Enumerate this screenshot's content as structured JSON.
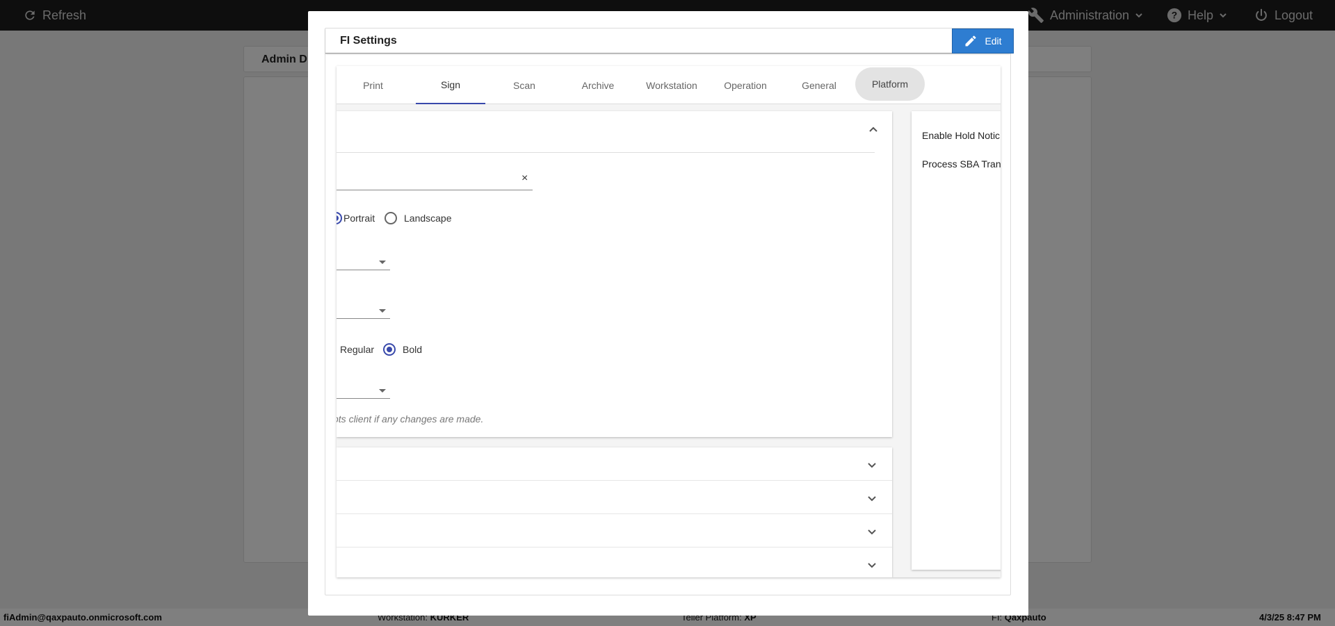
{
  "topbar": {
    "refresh_label": "Refresh",
    "administration_label": "Administration",
    "help_label": "Help",
    "logout_label": "Logout"
  },
  "page": {
    "title": "Admin D"
  },
  "footer": {
    "user": "fiAdmin@qaxpauto.onmicrosoft.com",
    "workstation_label": "Workstation:",
    "workstation_value": "KURKER",
    "platform_label": "Teller Platform:",
    "platform_value": "XP",
    "fi_label": "FI:",
    "fi_value": "Qaxpauto",
    "datetime": "4/3/25 8:47 PM"
  },
  "modal": {
    "title": "FI Settings",
    "edit_label": "Edit",
    "tabs": [
      {
        "label": "Print"
      },
      {
        "label": "Sign"
      },
      {
        "label": "Scan"
      },
      {
        "label": "Archive"
      },
      {
        "label": "Workstation"
      },
      {
        "label": "Operation"
      },
      {
        "label": "General"
      },
      {
        "label": "Platform"
      }
    ],
    "active_tab": "Sign",
    "clear_icon": "×",
    "orientation": {
      "options": [
        "Portrait",
        "Landscape"
      ],
      "selected": "Portrait"
    },
    "font_weight": {
      "options": [
        "Regular",
        "Bold"
      ],
      "selected": "Bold"
    },
    "hint": "pts client if any changes are made.",
    "side_panel": {
      "items": [
        "Enable Hold Notic",
        "Process SBA Tran"
      ]
    }
  },
  "colors": {
    "accent": "#3949ab",
    "edit_button": "#2e7dd1",
    "topbar": "#1c1c1c"
  }
}
